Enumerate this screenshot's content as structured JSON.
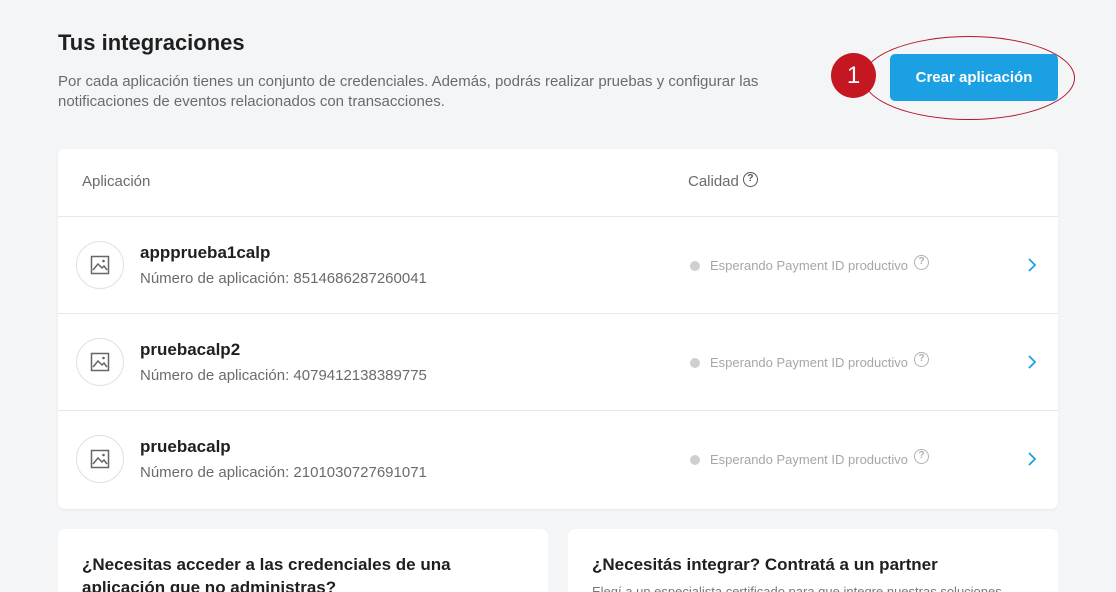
{
  "header": {
    "title": "Tus integraciones",
    "subtitle": "Por cada aplicación tienes un conjunto de credenciales. Además, podrás realizar pruebas y configurar las notificaciones de eventos relacionados con transacciones.",
    "create_button_label": "Crear aplicación",
    "annotation_number": "1"
  },
  "table": {
    "columns": [
      "Aplicación",
      "Calidad"
    ],
    "help_icon": "?",
    "rows": [
      {
        "name": "appprueba1calp",
        "number": "Número de aplicación: 8514686287260041",
        "status": "Esperando Payment ID productivo"
      },
      {
        "name": "pruebacalp2",
        "number": "Número de aplicación: 4079412138389775",
        "status": "Esperando Payment ID productivo"
      },
      {
        "name": "pruebacalp",
        "number": "Número de aplicación: 2101030727691071",
        "status": "Esperando Payment ID productivo"
      }
    ]
  },
  "bottom_cards": {
    "left": {
      "title": "¿Necesitas acceder a las credenciales de una aplicación que no administras?"
    },
    "right": {
      "title": "¿Necesitás integrar? Contratá a un partner",
      "text": "Elegí a un especialista certificado para que integre nuestras soluciones"
    }
  },
  "colors": {
    "accent": "#1aa0e3",
    "annotation": "#c41722",
    "background": "#f4f5f7"
  },
  "icons": {
    "app": "image-placeholder-icon",
    "help": "question-circle-icon",
    "row_action": "chevron-right-icon"
  }
}
